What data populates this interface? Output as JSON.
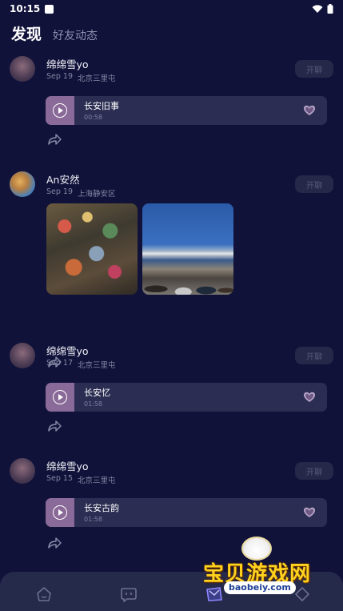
{
  "status_bar": {
    "time": "10:15"
  },
  "header": {
    "tab_active": "发现",
    "tab_inactive": "好友动态"
  },
  "posts": [
    {
      "username": "绵绵雪yo",
      "date": "Sep 19",
      "location": "北京三里屯",
      "follow": "开聊",
      "audio": {
        "title": "长安旧事",
        "duration": "00:58"
      }
    },
    {
      "username": "An安然",
      "date": "Sep 19",
      "location": "上海静安区",
      "follow": "开聊"
    },
    {
      "username": "绵绵雪yo",
      "date": "Sep 17",
      "location": "北京三里屯",
      "follow": "开聊",
      "audio": {
        "title": "长安忆",
        "duration": "01:58"
      }
    },
    {
      "username": "绵绵雪yo",
      "date": "Sep 15",
      "location": "北京三里屯",
      "follow": "开聊",
      "audio": {
        "title": "长安古韵",
        "duration": "01:58"
      }
    }
  ],
  "tabbar": {
    "icons": [
      "home-icon",
      "chat-icon",
      "discover-icon",
      "profile-icon"
    ]
  },
  "watermark": {
    "text": "宝贝游戏网",
    "url": "baobeiy.com"
  },
  "colors": {
    "background": "#10123a",
    "card": "#2b2e52",
    "play_box": "#8a6a98",
    "tabbar": "#252a4a"
  }
}
